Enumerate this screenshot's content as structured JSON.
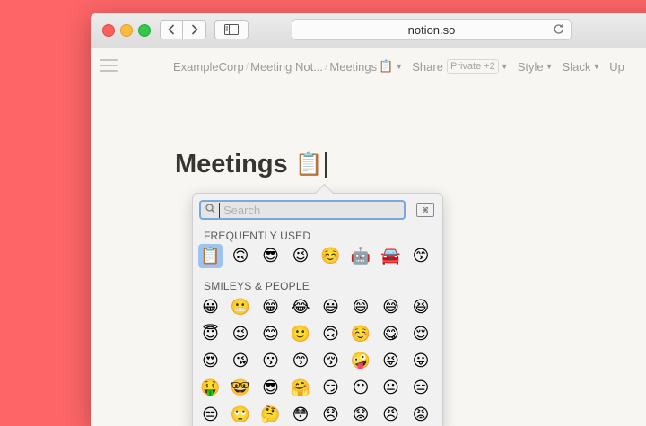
{
  "browser": {
    "url": "notion.so"
  },
  "breadcrumb": {
    "workspace": "ExampleCorp",
    "parent": "Meeting Not...",
    "current": "Meetings",
    "current_emoji": "📋"
  },
  "menu": {
    "share_label": "Share",
    "privacy_badge": "Private +2",
    "style_label": "Style",
    "slack_label": "Slack",
    "updates_label": "Up"
  },
  "page": {
    "title": "Meetings",
    "title_emoji": "📋"
  },
  "emoji_picker": {
    "search_placeholder": "Search",
    "frequent_label": "FREQUENTLY USED",
    "smileys_label": "SMILEYS & PEOPLE",
    "frequent": [
      "📋",
      "🙃",
      "😎",
      "😉",
      "☺️",
      "🤖",
      "🚘",
      "😙"
    ],
    "smileys_rows": [
      [
        "😀",
        "😬",
        "😁",
        "😂",
        "😃",
        "😄",
        "😅",
        "😆"
      ],
      [
        "😇",
        "😉",
        "😊",
        "🙂",
        "🙃",
        "☺️",
        "😋",
        "😌"
      ],
      [
        "😍",
        "😘",
        "😗",
        "😙",
        "😚",
        "🤪",
        "😝",
        "😛"
      ],
      [
        "🤑",
        "🤓",
        "😎",
        "🤗",
        "😏",
        "😶",
        "😐",
        "😑"
      ],
      [
        "😒",
        "🙄",
        "🤔",
        "😳",
        "😞",
        "😟",
        "😠",
        "😡"
      ]
    ]
  }
}
